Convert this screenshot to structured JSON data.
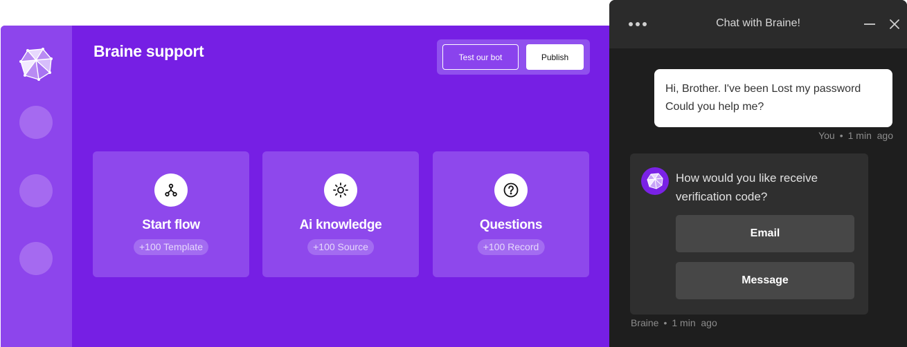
{
  "app": {
    "title": "Braine support",
    "actions": {
      "test_label": "Test our bot",
      "publish_label": "Publish"
    },
    "sidebar": {
      "logo": "braine-logo-icon",
      "nav_items": [
        "nav-item-1",
        "nav-item-2",
        "nav-item-3"
      ]
    },
    "cards": [
      {
        "title": "Start flow",
        "badge": "+100 Template",
        "icon": "flow-icon"
      },
      {
        "title": "Ai knowledge",
        "badge": "+100 Source",
        "icon": "sun-icon"
      },
      {
        "title": "Questions",
        "badge": "+100 Record",
        "icon": "question-icon"
      }
    ],
    "colors": {
      "primary": "#761fe4",
      "sidebar": "#8d45ec",
      "card": "#8e48ec"
    }
  },
  "chat": {
    "title": "Chat with Braine!",
    "user_message": {
      "line1": "Hi, Brother. I've been Lost my password",
      "line2": "Could you help me?",
      "author": "You",
      "time": "1 min  ago"
    },
    "bot_message": {
      "text": "How would you like receive verification code?",
      "author": "Braine",
      "time": "1 min  ago"
    },
    "options": [
      "Email",
      "Message"
    ],
    "colors": {
      "panel": "#1e1e1e",
      "header": "#2b2b2b",
      "bubble": "#2f2f2f",
      "option": "#474747"
    }
  }
}
